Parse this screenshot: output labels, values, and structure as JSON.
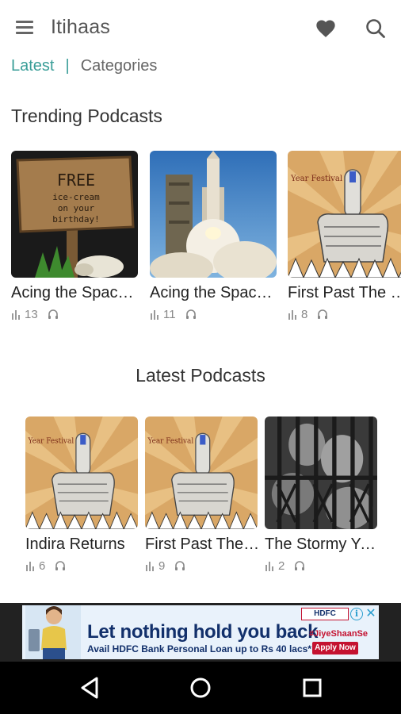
{
  "app": {
    "title": "Itihaas"
  },
  "icons": {
    "menu": "menu-icon",
    "favorites": "heart-icon",
    "search": "search-icon",
    "plays": "bar-chart-icon",
    "listens": "headphones-icon"
  },
  "colors": {
    "accent": "#3a9e98",
    "text": "#222222",
    "muted": "#888888",
    "navbar": "#000000"
  },
  "tabs": {
    "latest": "Latest",
    "separator": "|",
    "categories": "Categories",
    "active": "Latest"
  },
  "trending": {
    "title": "Trending Podcasts",
    "items": [
      {
        "title": "Acing the Space Race",
        "plays": "13",
        "art": "free-icecream-signboard"
      },
      {
        "title": "Acing the Space Race",
        "plays": "11",
        "art": "rocket-launch"
      },
      {
        "title": "First Past The Post",
        "plays": "8",
        "art": "election-ink-finger"
      }
    ]
  },
  "latest": {
    "title": "Latest Podcasts",
    "items": [
      {
        "title": "Indira Returns",
        "plays": "6",
        "art": "election-ink-finger"
      },
      {
        "title": "First Past The Post",
        "plays": "9",
        "art": "election-ink-finger"
      },
      {
        "title": "The Stormy Years",
        "plays": "2",
        "art": "prison-bars"
      }
    ]
  },
  "thumb_text": {
    "free_sign": [
      "FREE",
      "ice-cream",
      "on your",
      "birthday!"
    ],
    "festival": "Year Festival !"
  },
  "ad": {
    "headline": "Let nothing hold you back",
    "subline": "Avail HDFC Bank Personal Loan up to Rs 40 lacs*",
    "brand": "HDFC",
    "tag": "#JiyeShaanSe",
    "cta": "Apply Now",
    "info": "i",
    "close": "✕"
  },
  "navbar": {
    "back": "back-icon",
    "home": "home-icon",
    "recents": "recents-icon"
  }
}
